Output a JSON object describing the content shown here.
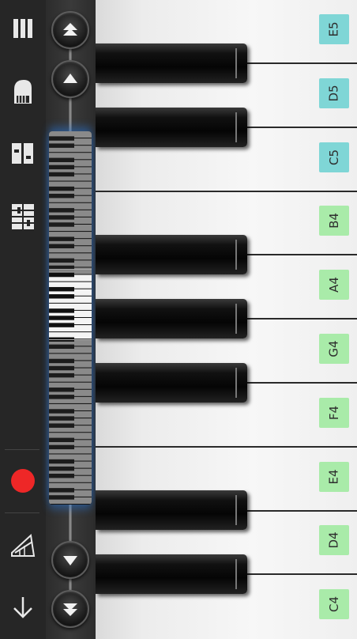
{
  "toolbar": {
    "menu_icon": "hamburger-menu-icon",
    "instrument_icon": "grand-piano-icon",
    "dual_keyboard_icon": "dual-keyboard-icon",
    "keyboard_layout_icon": "keyboard-layout-icon",
    "record_icon": "record-icon",
    "metronome_icon": "metronome-icon",
    "collapse_icon": "arrow-down-icon",
    "record_color": "#ee2727"
  },
  "navigation": {
    "scroll_up_fast": "double-up-arrow-icon",
    "scroll_up": "up-arrow-icon",
    "scroll_down": "down-arrow-icon",
    "scroll_down_fast": "double-down-arrow-icon"
  },
  "piano": {
    "white_keys": [
      {
        "note": "E5",
        "octave": 5
      },
      {
        "note": "D5",
        "octave": 5
      },
      {
        "note": "C5",
        "octave": 5
      },
      {
        "note": "B4",
        "octave": 4
      },
      {
        "note": "A4",
        "octave": 4
      },
      {
        "note": "G4",
        "octave": 4
      },
      {
        "note": "F4",
        "octave": 4
      },
      {
        "note": "E4",
        "octave": 4
      },
      {
        "note": "D4",
        "octave": 4
      },
      {
        "note": "C4",
        "octave": 4
      }
    ],
    "black_keys": [
      "D#5",
      "C#5",
      "A#4",
      "G#4",
      "F#4",
      "D#4",
      "C#4"
    ],
    "label_colors": {
      "octave5": "#7fd6d6",
      "octave4": "#a9eba9"
    }
  }
}
